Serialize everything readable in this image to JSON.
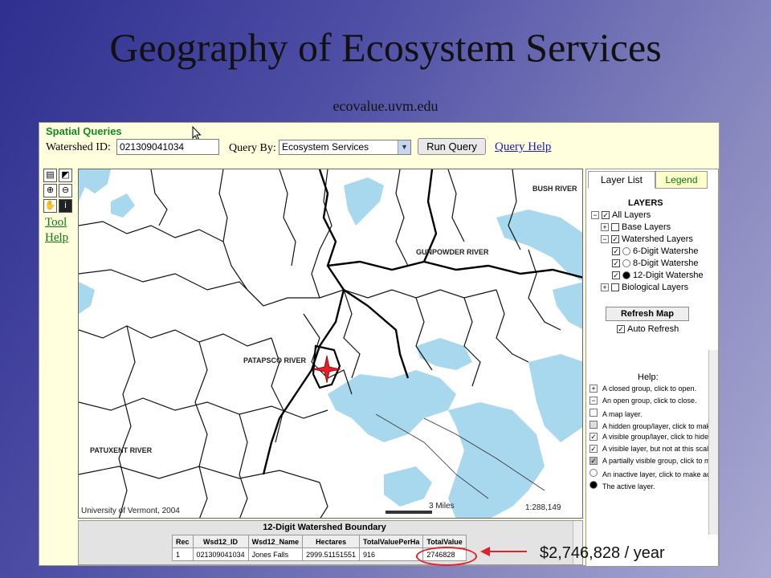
{
  "slide": {
    "title": "Geography of Ecosystem Services",
    "subtitle": "ecovalue.uvm.edu"
  },
  "query_bar": {
    "heading": "Spatial Queries",
    "watershed_label": "Watershed ID:",
    "watershed_value": "021309041034",
    "query_by_label": "Query By:",
    "query_by_value": "Ecosystem Services",
    "run_button": "Run Query",
    "help_link": "Query Help"
  },
  "tools": {
    "tool_link": "Tool",
    "help_link": "Help"
  },
  "map": {
    "labels": {
      "bush_river": "BUSH RIVER",
      "gunpowder_river": "GUNPOWDER RIVER",
      "patapsco_river": "PATAPSCO RIVER",
      "patuxent_river": "PATUXENT RIVER"
    },
    "copyright": "University of Vermont, 2004",
    "scale_text": "3 Miles",
    "ratio": "1:288,149"
  },
  "side_panel": {
    "tabs": [
      "Layer List",
      "Legend"
    ],
    "layers_heading": "LAYERS",
    "tree": [
      "All Layers",
      "Base Layers",
      "Watershed Layers",
      "6-Digit Watershe",
      "8-Digit Watershe",
      "12-Digit Watershe",
      "Biological Layers"
    ],
    "refresh_button": "Refresh Map",
    "auto_refresh": "Auto Refresh",
    "help_heading": "Help:",
    "help_items": [
      "A closed group, click to open.",
      "An open group, click to close.",
      "A map layer.",
      "A hidden group/layer, click to make",
      "A visible group/layer, click to hide.",
      "A visible layer, but not at this scale.",
      "A partially visible group, click to make",
      "An inactive layer, click to make activ",
      "The active layer."
    ]
  },
  "results": {
    "title": "12-Digit Watershed Boundary",
    "columns": [
      "Rec",
      "Wsd12_ID",
      "Wsd12_Name",
      "Hectares",
      "TotalValuePerHa",
      "TotalValue"
    ],
    "rows": [
      [
        "1",
        "021309041034",
        "Jones Falls",
        "2999.51151551",
        "916",
        "2746828"
      ]
    ]
  },
  "annotation": {
    "value_text": "$2,746,828  / year",
    "accent_color": "#e0202a"
  }
}
